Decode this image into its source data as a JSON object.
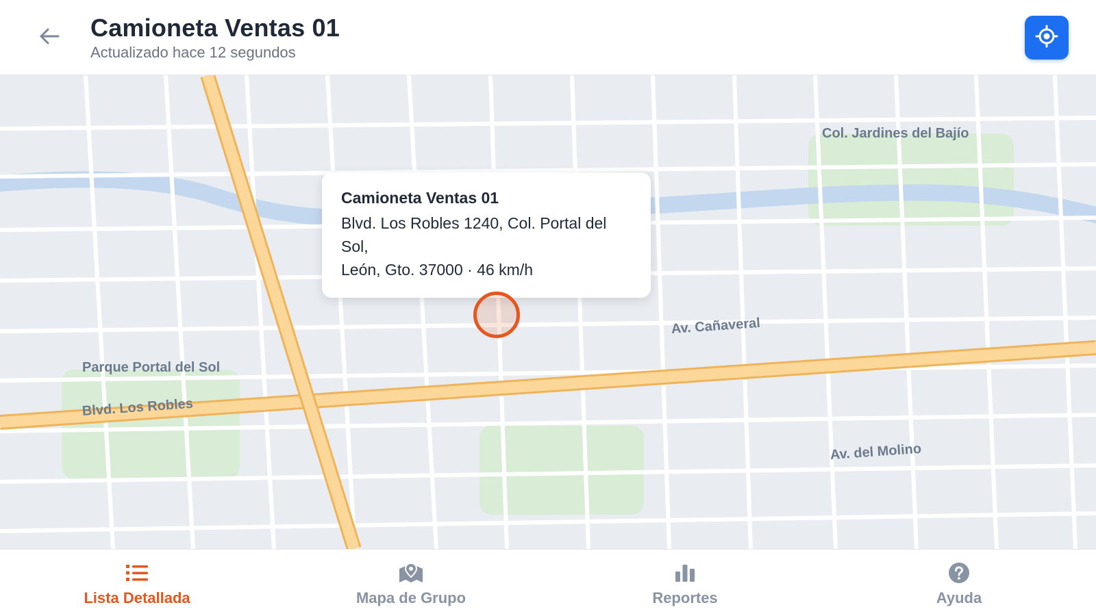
{
  "header": {
    "title": "Camioneta Ventas 01",
    "subtitle": "Actualizado hace 12 segundos",
    "back_icon": "arrow-left-icon",
    "locate_icon": "crosshair-icon"
  },
  "map": {
    "labels": {
      "jardines": "Col. Jardines del Bajío",
      "canaveral": "Av. Cañaveral",
      "parque": "Parque Portal del Sol",
      "robles": "Blvd. Los Robles",
      "molino": "Av. del Molino"
    },
    "popup": {
      "title": "Camioneta Ventas 01",
      "line1": "Blvd. Los Robles 1240, Col. Portal del",
      "line2": "Sol,",
      "line3": "León, Gto. 37000 · 46 km/h"
    }
  },
  "nav": {
    "items": [
      {
        "label": "Lista Detallada",
        "icon": "list-icon",
        "active": true
      },
      {
        "label": "Mapa de Grupo",
        "icon": "map-pin-icon",
        "active": false
      },
      {
        "label": "Reportes",
        "icon": "bar-chart-icon",
        "active": false
      },
      {
        "label": "Ayuda",
        "icon": "help-icon",
        "active": false
      }
    ]
  },
  "colors": {
    "accent": "#e4571f",
    "primary_button": "#1d6ff2",
    "inactive": "#8893a3",
    "road_major": "#fcd79a",
    "water": "#c7daf1",
    "park": "#d9ecd6"
  }
}
